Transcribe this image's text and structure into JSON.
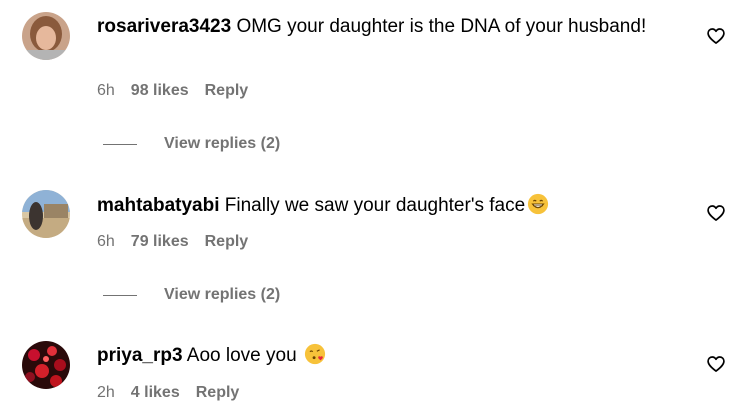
{
  "comments": [
    {
      "username": "rosarivera3423",
      "text": "OMG your daughter is the DNA of your husband!",
      "time": "6h",
      "likes": "98 likes",
      "reply": "Reply",
      "view_replies": "View replies (2)",
      "avatar_icon": "avatar-photo-woman",
      "like_icon": "heart-outline-icon"
    },
    {
      "username": "mahtabatyabi",
      "text": "Finally we saw your daughter's face",
      "emoji": "grinning-face-emoji",
      "time": "6h",
      "likes": "79 likes",
      "reply": "Reply",
      "view_replies": "View replies (2)",
      "avatar_icon": "avatar-photo-landscape",
      "like_icon": "heart-outline-icon"
    },
    {
      "username": "priya_rp3",
      "text": "Aoo love you",
      "emoji": "face-blowing-kiss-emoji",
      "time": "2h",
      "likes": "4 likes",
      "reply": "Reply",
      "avatar_icon": "avatar-photo-red",
      "like_icon": "heart-outline-icon"
    }
  ]
}
